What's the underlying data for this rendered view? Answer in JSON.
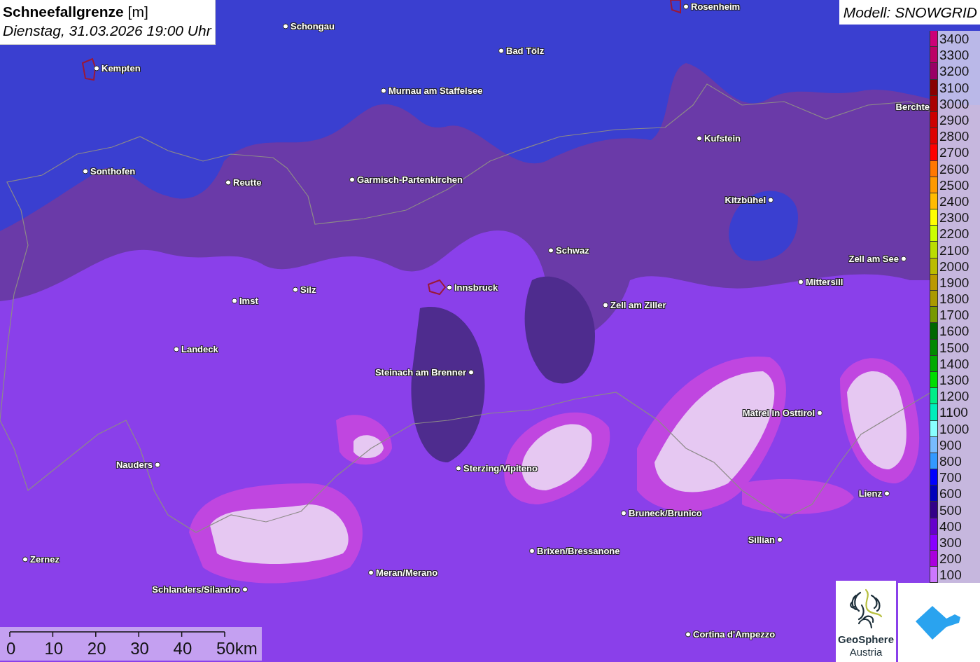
{
  "header": {
    "title": "Schneefallgrenze",
    "unit": "[m]",
    "datetime": "Dienstag, 31.03.2026 19:00 Uhr"
  },
  "model": "Modell: SNOWGRID",
  "legend": [
    {
      "label": "3400",
      "color": "#cc0077"
    },
    {
      "label": "3300",
      "color": "#bb0066"
    },
    {
      "label": "3200",
      "color": "#990066"
    },
    {
      "label": "3100",
      "color": "#880000"
    },
    {
      "label": "3000",
      "color": "#aa0000"
    },
    {
      "label": "2900",
      "color": "#cc0000"
    },
    {
      "label": "2800",
      "color": "#dd0000"
    },
    {
      "label": "2700",
      "color": "#ff0000"
    },
    {
      "label": "2600",
      "color": "#ff7700"
    },
    {
      "label": "2500",
      "color": "#ff9900"
    },
    {
      "label": "2400",
      "color": "#ffbb00"
    },
    {
      "label": "2300",
      "color": "#ffff00"
    },
    {
      "label": "2200",
      "color": "#ccff00"
    },
    {
      "label": "2100",
      "color": "#bbdd00"
    },
    {
      "label": "2000",
      "color": "#bbbb00"
    },
    {
      "label": "1900",
      "color": "#bb9900"
    },
    {
      "label": "1800",
      "color": "#aa9900"
    },
    {
      "label": "1700",
      "color": "#779900"
    },
    {
      "label": "1600",
      "color": "#006600"
    },
    {
      "label": "1500",
      "color": "#008800"
    },
    {
      "label": "1400",
      "color": "#00aa00"
    },
    {
      "label": "1300",
      "color": "#00dd00"
    },
    {
      "label": "1200",
      "color": "#00ee88"
    },
    {
      "label": "1100",
      "color": "#00eebb"
    },
    {
      "label": "1000",
      "color": "#88ffff"
    },
    {
      "label": "900",
      "color": "#77bbff"
    },
    {
      "label": "800",
      "color": "#3399ff"
    },
    {
      "label": "700",
      "color": "#0000ff"
    },
    {
      "label": "600",
      "color": "#0000bb"
    },
    {
      "label": "500",
      "color": "#330088"
    },
    {
      "label": "400",
      "color": "#6600cc"
    },
    {
      "label": "300",
      "color": "#8800ff"
    },
    {
      "label": "200",
      "color": "#aa00dd"
    },
    {
      "label": "100",
      "color": "#cc77ff"
    }
  ],
  "cities": [
    {
      "name": "Rosenheim"
    },
    {
      "name": "Schongau"
    },
    {
      "name": "Bad Tölz"
    },
    {
      "name": "Kempten"
    },
    {
      "name": "Murnau am Staffelsee"
    },
    {
      "name": "Berchte"
    },
    {
      "name": "Kufstein"
    },
    {
      "name": "Sonthofen"
    },
    {
      "name": "Garmisch-Partenkirchen"
    },
    {
      "name": "Reutte"
    },
    {
      "name": "Kitzbühel"
    },
    {
      "name": "Schwaz"
    },
    {
      "name": "Zell am See"
    },
    {
      "name": "Mittersill"
    },
    {
      "name": "Innsbruck"
    },
    {
      "name": "Silz"
    },
    {
      "name": "Imst"
    },
    {
      "name": "Zell am Ziller"
    },
    {
      "name": "Landeck"
    },
    {
      "name": "Steinach am Brenner"
    },
    {
      "name": "Matrei in Osttirol"
    },
    {
      "name": "Nauders"
    },
    {
      "name": "Sterzing/Vipiteno"
    },
    {
      "name": "Lienz"
    },
    {
      "name": "Bruneck/Brunico"
    },
    {
      "name": "Sillian"
    },
    {
      "name": "Brixen/Bressanone"
    },
    {
      "name": "Zernez"
    },
    {
      "name": "Meran/Merano"
    },
    {
      "name": "Schlanders/Silandro"
    },
    {
      "name": "Cortina d'Ampezzo"
    }
  ],
  "scale_bar": {
    "labels": [
      "0",
      "10",
      "20",
      "30",
      "40",
      "50km"
    ]
  },
  "logo": {
    "name": "GeoSphere",
    "caption": "Austria"
  }
}
